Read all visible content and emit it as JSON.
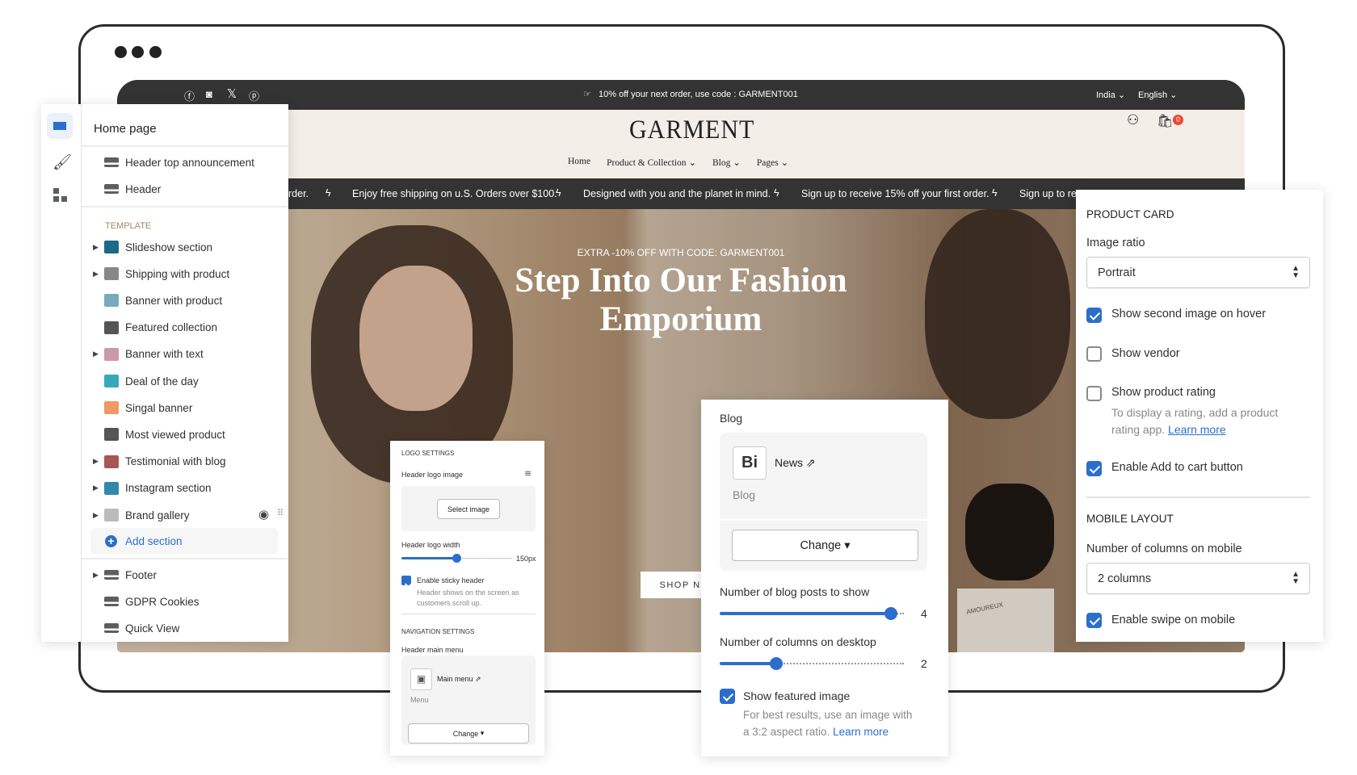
{
  "store": {
    "announcement": "10% off your next order, use code : GARMENT001",
    "country": "India",
    "language": "English",
    "logo": "GARMENT",
    "nav": [
      "Home",
      "Product & Collection",
      "Blog",
      "Pages"
    ],
    "cart_count": "0",
    "marquee": [
      "rder.",
      "Enjoy free shipping on u.S. Orders over $100.",
      "Designed with you and the planet in mind.",
      "Sign up to receive 15% off your first order.",
      "Sign up to rec"
    ],
    "hero": {
      "eyebrow": "EXTRA -10% OFF WITH CODE: GARMENT001",
      "heading_1": "Step Into Our Fashion",
      "heading_2": "Emporium",
      "button": "SHOP NOW"
    },
    "tag": "AMOUREUX"
  },
  "sidebar": {
    "title": "Home page",
    "header_items": [
      "Header top announcement",
      "Header"
    ],
    "template_label": "TEMPLATE",
    "template_items": [
      {
        "label": "Slideshow section",
        "expandable": true
      },
      {
        "label": "Shipping with product",
        "expandable": true
      },
      {
        "label": "Banner with product",
        "expandable": false
      },
      {
        "label": "Featured collection",
        "expandable": false
      },
      {
        "label": "Banner with text",
        "expandable": true
      },
      {
        "label": "Deal of the day",
        "expandable": false
      },
      {
        "label": "Singal banner",
        "expandable": false
      },
      {
        "label": "Most viewed product",
        "expandable": false
      },
      {
        "label": "Testimonial with blog",
        "expandable": true
      },
      {
        "label": "Instagram section",
        "expandable": true
      },
      {
        "label": "Brand gallery",
        "expandable": true
      }
    ],
    "add_section": "Add section",
    "footer_items": [
      {
        "label": "Footer",
        "expandable": true
      },
      {
        "label": "GDPR Cookies",
        "expandable": false
      },
      {
        "label": "Quick View",
        "expandable": false
      }
    ],
    "accent": "#2c6ecb"
  },
  "logo_panel": {
    "section": "LOGO SETTINGS",
    "logo_image_label": "Header logo image",
    "select_image": "Select image",
    "width_label": "Header logo width",
    "width_value": "150px",
    "width_fraction": 0.5,
    "sticky_label": "Enable sticky header",
    "sticky_checked": true,
    "sticky_help_1": "Header shows on the screen as",
    "sticky_help_2": "customers scroll up.",
    "nav_section": "NAVIGATION SETTINGS",
    "menu_label": "Header main menu",
    "menu_name": "Main menu",
    "menu_type": "Menu",
    "change": "Change"
  },
  "blog_panel": {
    "label": "Blog",
    "blog_name": "News",
    "blog_type": "Blog",
    "change": "Change",
    "posts_label": "Number of blog posts to show",
    "posts_value": "4",
    "posts_fraction": 1.0,
    "columns_label": "Number of columns on desktop",
    "columns_value": "2",
    "columns_fraction": 0.33,
    "featured_label": "Show featured image",
    "featured_checked": true,
    "featured_help_1": "For best results, use an image with",
    "featured_help_2": "a 3:2 aspect ratio.",
    "learn_more": "Learn more"
  },
  "product_panel": {
    "section": "PRODUCT CARD",
    "ratio_label": "Image ratio",
    "ratio_value": "Portrait",
    "second_image": "Show second image on hover",
    "vendor": "Show vendor",
    "rating": "Show product rating",
    "rating_help_1": "To display a rating, add a product",
    "rating_help_2": "rating app.",
    "learn_more": "Learn more",
    "add_to_cart": "Enable Add to cart button",
    "mobile_section": "MOBILE LAYOUT",
    "mobile_columns_label": "Number of columns on mobile",
    "mobile_columns_value": "2 columns",
    "swipe": "Enable swipe on mobile"
  }
}
